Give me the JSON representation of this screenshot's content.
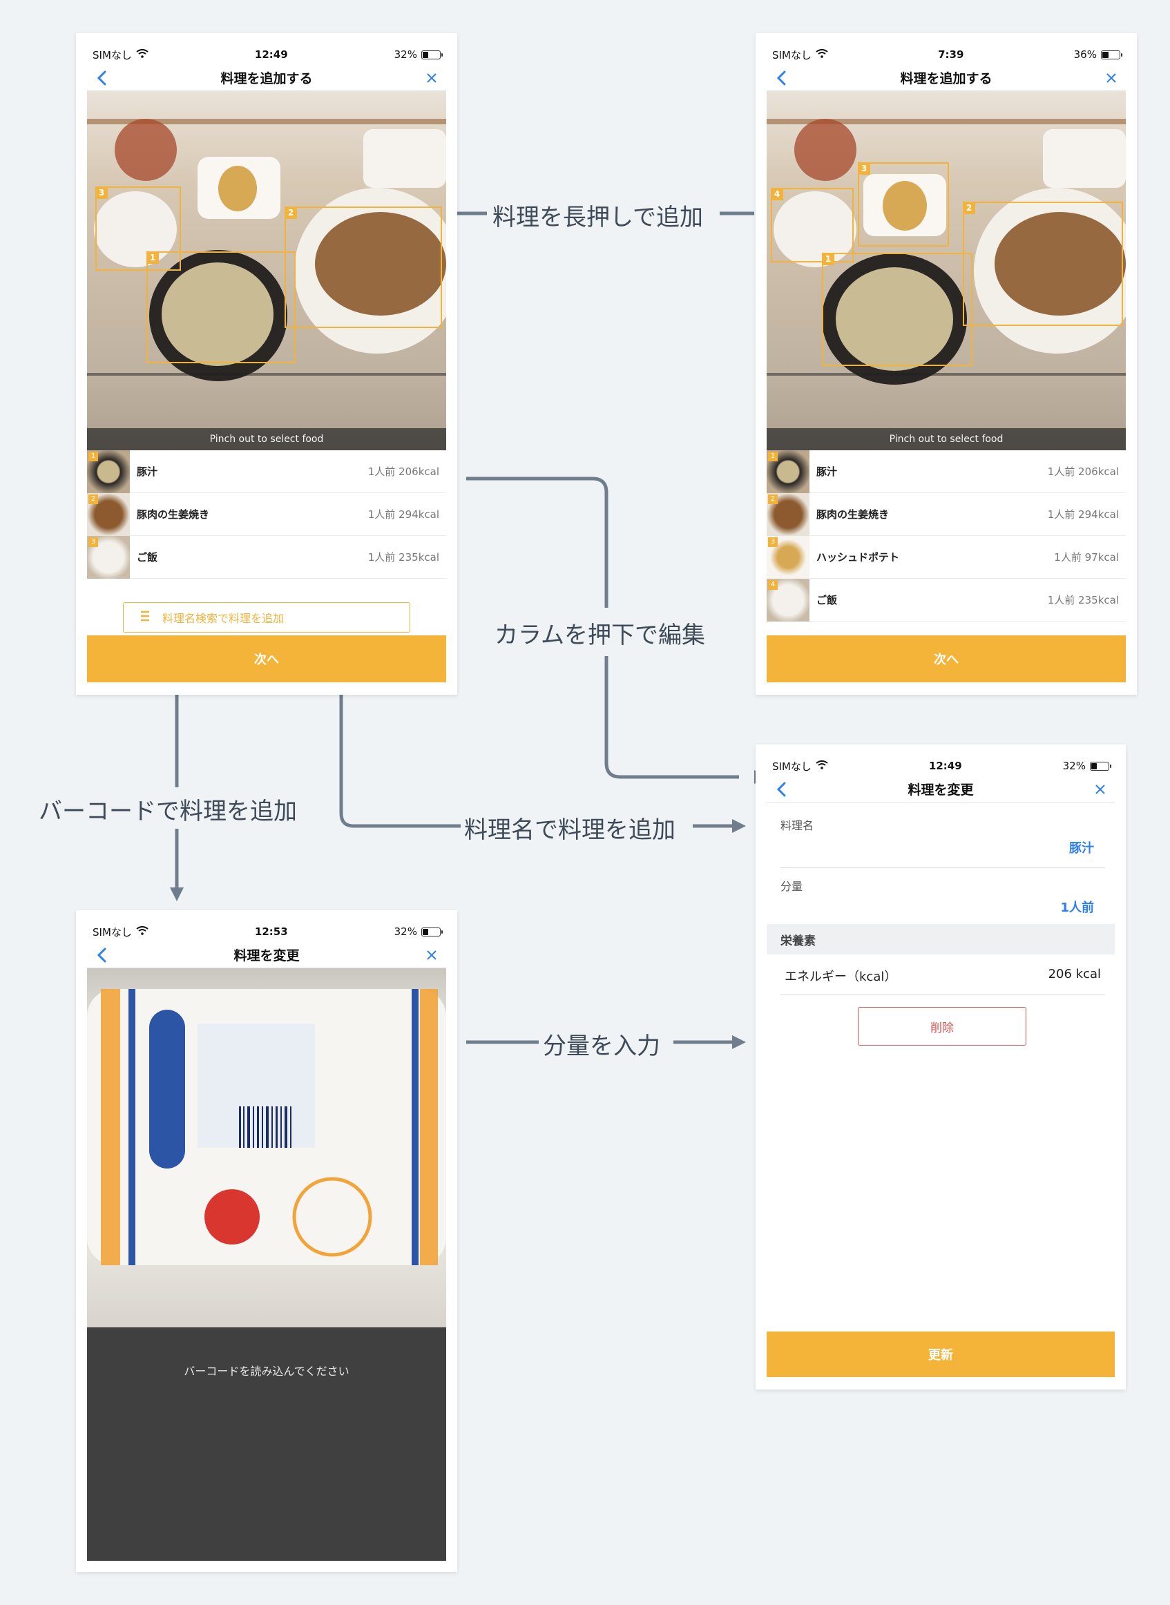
{
  "colors": {
    "accent": "#f4b43a",
    "link_blue": "#2f80ed",
    "connector": "#6f7d8c",
    "delete_red": "#d9534f"
  },
  "screen_add_1": {
    "status": {
      "carrier": "SIMなし",
      "time": "12:49",
      "battery": "32%"
    },
    "nav_title": "料理を追加する",
    "pinch_hint": "Pinch out to select food",
    "items": [
      {
        "num": "1",
        "name": "豚汁",
        "kcal": "1人前 206kcal"
      },
      {
        "num": "2",
        "name": "豚肉の生姜焼き",
        "kcal": "1人前 294kcal"
      },
      {
        "num": "3",
        "name": "ご飯",
        "kcal": "1人前 235kcal"
      }
    ],
    "box_labels": [
      "3",
      "2",
      "1"
    ],
    "search_placeholder": "料理名検索で料理を追加",
    "next_label": "次へ"
  },
  "screen_add_2": {
    "status": {
      "carrier": "SIMなし",
      "time": "7:39",
      "battery": "36%"
    },
    "nav_title": "料理を追加する",
    "pinch_hint": "Pinch out to select food",
    "items": [
      {
        "num": "1",
        "name": "豚汁",
        "kcal": "1人前 206kcal"
      },
      {
        "num": "2",
        "name": "豚肉の生姜焼き",
        "kcal": "1人前 294kcal"
      },
      {
        "num": "3",
        "name": "ハッシュドポテト",
        "kcal": "1人前 97kcal"
      },
      {
        "num": "4",
        "name": "ご飯",
        "kcal": "1人前 235kcal"
      }
    ],
    "box_labels": [
      "3",
      "4",
      "2",
      "1"
    ],
    "next_label": "次へ"
  },
  "screen_edit": {
    "status": {
      "carrier": "SIMなし",
      "time": "12:49",
      "battery": "32%"
    },
    "nav_title": "料理を変更",
    "name_label": "料理名",
    "name_value": "豚汁",
    "amount_label": "分量",
    "amount_value": "1人前",
    "nutrients_header": "栄養素",
    "energy_label": "エネルギー（kcal）",
    "energy_value": "206 kcal",
    "delete_label": "削除",
    "update_label": "更新"
  },
  "screen_barcode": {
    "status": {
      "carrier": "SIMなし",
      "time": "12:53",
      "battery": "32%"
    },
    "nav_title": "料理を変更",
    "hint": "バーコードを読み込んでください"
  },
  "annotations": {
    "long_press": "料理を長押しで追加",
    "tap_column": "カラムを押下で編集",
    "barcode_add": "バーコードで料理を追加",
    "name_add": "料理名で料理を追加",
    "amount_input": "分量を入力"
  }
}
